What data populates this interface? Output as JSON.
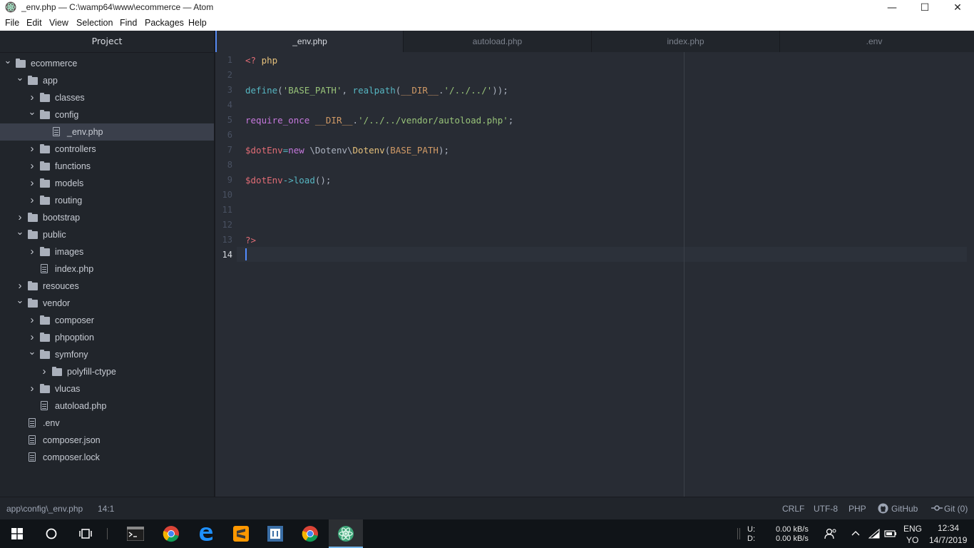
{
  "window": {
    "title": "_env.php — C:\\wamp64\\www\\ecommerce — Atom",
    "minimize": "—",
    "maximize": "☐",
    "close": "✕"
  },
  "menu": [
    "File",
    "Edit",
    "View",
    "Selection",
    "Find",
    "Packages",
    "Help"
  ],
  "tree": {
    "header": "Project",
    "items": [
      {
        "label": "ecommerce",
        "type": "folder",
        "level": 0,
        "expanded": true
      },
      {
        "label": "app",
        "type": "folder",
        "level": 1,
        "expanded": true
      },
      {
        "label": "classes",
        "type": "folder",
        "level": 2,
        "expanded": false
      },
      {
        "label": "config",
        "type": "folder",
        "level": 2,
        "expanded": true
      },
      {
        "label": "_env.php",
        "type": "file",
        "level": 3,
        "selected": true
      },
      {
        "label": "controllers",
        "type": "folder",
        "level": 2,
        "expanded": false
      },
      {
        "label": "functions",
        "type": "folder",
        "level": 2,
        "expanded": false
      },
      {
        "label": "models",
        "type": "folder",
        "level": 2,
        "expanded": false
      },
      {
        "label": "routing",
        "type": "folder",
        "level": 2,
        "expanded": false
      },
      {
        "label": "bootstrap",
        "type": "folder",
        "level": 1,
        "expanded": false
      },
      {
        "label": "public",
        "type": "folder",
        "level": 1,
        "expanded": true
      },
      {
        "label": "images",
        "type": "folder",
        "level": 2,
        "expanded": false
      },
      {
        "label": "index.php",
        "type": "file",
        "level": 2
      },
      {
        "label": "resouces",
        "type": "folder",
        "level": 1,
        "expanded": false
      },
      {
        "label": "vendor",
        "type": "folder",
        "level": 1,
        "expanded": true
      },
      {
        "label": "composer",
        "type": "folder",
        "level": 2,
        "expanded": false
      },
      {
        "label": "phpoption",
        "type": "folder",
        "level": 2,
        "expanded": false
      },
      {
        "label": "symfony",
        "type": "folder",
        "level": 2,
        "expanded": true
      },
      {
        "label": "polyfill-ctype",
        "type": "folder",
        "level": 3,
        "expanded": false
      },
      {
        "label": "vlucas",
        "type": "folder",
        "level": 2,
        "expanded": false
      },
      {
        "label": "autoload.php",
        "type": "file",
        "level": 2
      },
      {
        "label": ".env",
        "type": "file",
        "level": 1
      },
      {
        "label": "composer.json",
        "type": "file",
        "level": 1
      },
      {
        "label": "composer.lock",
        "type": "file",
        "level": 1
      }
    ]
  },
  "tabs": [
    {
      "label": "_env.php",
      "active": true
    },
    {
      "label": "autoload.php",
      "active": false
    },
    {
      "label": "index.php",
      "active": false
    },
    {
      "label": ".env",
      "active": false
    }
  ],
  "editor": {
    "line_numbers": [
      "1",
      "2",
      "3",
      "4",
      "5",
      "6",
      "7",
      "8",
      "9",
      "10",
      "11",
      "12",
      "13",
      "14"
    ],
    "current_line": 14,
    "lines": [
      [
        {
          "t": "<? ",
          "c": "k-tag"
        },
        {
          "t": "php",
          "c": "k-php"
        }
      ],
      [],
      [
        {
          "t": "define",
          "c": "k-fn"
        },
        {
          "t": "(",
          "c": "k-punc"
        },
        {
          "t": "'BASE_PATH'",
          "c": "k-str"
        },
        {
          "t": ", ",
          "c": "k-punc"
        },
        {
          "t": "realpath",
          "c": "k-fn"
        },
        {
          "t": "(",
          "c": "k-punc"
        },
        {
          "t": "__DIR__",
          "c": "k-const"
        },
        {
          "t": ".",
          "c": "k-punc"
        },
        {
          "t": "'/../../'",
          "c": "k-str"
        },
        {
          "t": "));",
          "c": "k-punc"
        }
      ],
      [],
      [
        {
          "t": "require_once",
          "c": "k-kw"
        },
        {
          "t": " ",
          "c": "k-plain"
        },
        {
          "t": "__DIR__",
          "c": "k-const"
        },
        {
          "t": ".",
          "c": "k-punc"
        },
        {
          "t": "'/../../vendor/autoload.php'",
          "c": "k-str"
        },
        {
          "t": ";",
          "c": "k-punc"
        }
      ],
      [],
      [
        {
          "t": "$dotEnv",
          "c": "k-var"
        },
        {
          "t": "=",
          "c": "k-fn"
        },
        {
          "t": "new",
          "c": "k-kw"
        },
        {
          "t": " \\Dotenv\\",
          "c": "k-plain"
        },
        {
          "t": "Dotenv",
          "c": "k-cls"
        },
        {
          "t": "(",
          "c": "k-punc"
        },
        {
          "t": "BASE_PATH",
          "c": "k-const"
        },
        {
          "t": ");",
          "c": "k-punc"
        }
      ],
      [],
      [
        {
          "t": "$dotEnv",
          "c": "k-var"
        },
        {
          "t": "->",
          "c": "k-fn"
        },
        {
          "t": "load",
          "c": "k-fn"
        },
        {
          "t": "();",
          "c": "k-punc"
        }
      ],
      [],
      [],
      [],
      [
        {
          "t": "?>",
          "c": "k-tag"
        }
      ],
      []
    ]
  },
  "status": {
    "path": "app\\config\\_env.php",
    "cursor": "14:1",
    "line_ending": "CRLF",
    "encoding": "UTF-8",
    "grammar": "PHP",
    "github": "GitHub",
    "git": "Git (0)"
  },
  "taskbar": {
    "net_up_label": "U:",
    "net_down_label": "D:",
    "net_up": "0.00 kB/s",
    "net_down": "0.00 kB/s",
    "lang": "ENG",
    "lang2": "YO",
    "time": "12:34",
    "date": "14/7/2019"
  }
}
